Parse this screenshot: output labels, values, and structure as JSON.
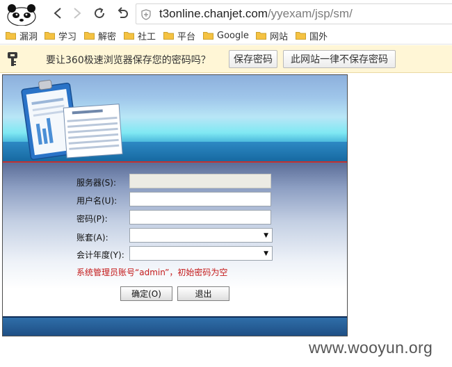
{
  "browser": {
    "url_host": "t3online.chanjet.com",
    "url_path": "/yyexam/jsp/sm/"
  },
  "bookmarks": [
    {
      "label": "漏洞"
    },
    {
      "label": "学习"
    },
    {
      "label": "解密"
    },
    {
      "label": "社工"
    },
    {
      "label": "平台"
    },
    {
      "label": "Google"
    },
    {
      "label": "网站"
    },
    {
      "label": "国外"
    }
  ],
  "password_bar": {
    "message": "要让360极速浏览器保存您的密码吗？",
    "save_label": "保存密码",
    "never_label": "此网站一律不保存密码"
  },
  "login": {
    "server_label": "服务器(S):",
    "server_value": "",
    "username_label": "用户名(U):",
    "username_value": "",
    "password_label": "密码(P):",
    "password_value": "",
    "account_label": "账套(A):",
    "account_selected": "",
    "year_label": "会计年度(Y):",
    "year_selected": "",
    "hint": "系统管理员账号“admin”，初始密码为空",
    "ok_label": "确定(O)",
    "exit_label": "退出"
  },
  "watermark": "www.wooyun.org",
  "colors": {
    "hint_red": "#c41a1a",
    "infobar_bg": "#fff6d6",
    "banner_line": "#c4312f",
    "footer_blue": "#1e4f85"
  }
}
